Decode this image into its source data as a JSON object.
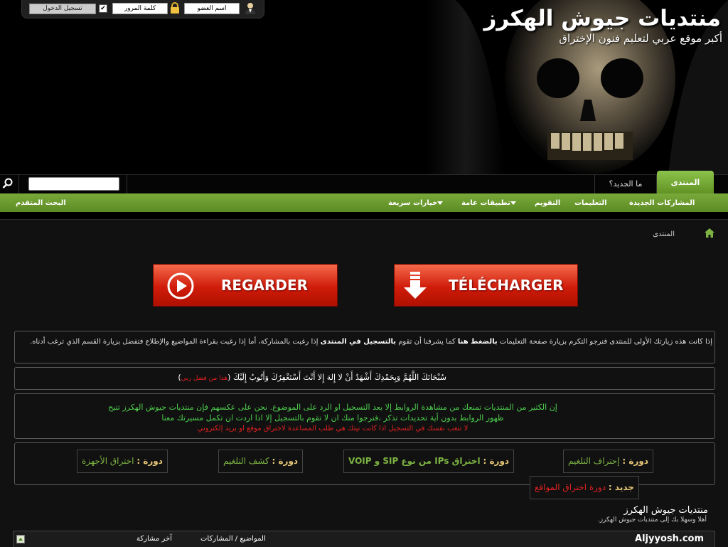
{
  "header": {
    "title": "منتديات جيوش الهكرز",
    "tagline": "أكبر موقع عربي لتعليم فنون الإختراق"
  },
  "login": {
    "username_placeholder": "اسم العضو",
    "password_placeholder": "كلمة المرور",
    "remember_checked": "✔",
    "login_button": "تسجيل الدخول"
  },
  "nav": {
    "forum_tab": "المنتدى",
    "whats_new_tab": "ما الجديد؟",
    "search_placeholder": ""
  },
  "subnav": {
    "items": [
      "المشاركات الجديدة",
      "التعليمات",
      "التقويم",
      "تطبيقات عامة",
      "خيارات سريعة"
    ],
    "advanced_search": "البحث المتقدم"
  },
  "breadcrumb": {
    "current": "المنتدى"
  },
  "buttons": {
    "watch": "REGARDER",
    "download": "TÉLÉCHARGER"
  },
  "welcome": {
    "part1": "إذا كانت هذه زيارتك الأولى للمنتدى فنرجو التكرم بزيارة صفحة التعليمات",
    "link1": "بالضغط هنا",
    "part2": "كما يشرفنا أن تقوم",
    "link2": "بالتسجيل في المنتدى",
    "part3": "إذا رغبت بالمشاركة، أما إذا رغبت بقراءة المواضيع والإطلاع فتفضل بزيارة القسم الذي ترغب أدناه."
  },
  "dhikr": {
    "text": "سُبْحَانَكَ اللَّهُمَّ وَبِحَمْدِكَ أَشْهَدُ أَنْ لا إِلهَ إِلا أَنْتَ أَسْتَغْفِرُكَ وَأَتُوبُ إِلَيْكَ (",
    "credit": "هذا من فضل ربي",
    "close": ")"
  },
  "notice": {
    "line1": "إن الكثير من المنتديات تمنعك من مشاهدة الروابط إلا بعد التسجيل او الرد على الموضوع. نحن على عكسهم فإن منتديات جيوش الهكرز تتيح",
    "line2": "ظهور الروابط بدون أية تحديدات تذكر ،فنرجوا منك ان لا تقوم بالتسجيل إلا اذا اردت ان تكمل مسيرتك معنا",
    "line3": "لا تتعب نفسك في التسجيل اذا كانت نيتك هي طلب المساعدة لاختراق موقع او بريد إلكتروني"
  },
  "courses": [
    {
      "prefix": "دورة :",
      "name": "إحتراف التلغيم"
    },
    {
      "prefix": "دورة :",
      "name": "اختراق IPs من نوع SIP و VOIP"
    },
    {
      "prefix": "دورة :",
      "name": "كشف التلغيم"
    },
    {
      "prefix": "دورة :",
      "name": "اختراق الأجهزة"
    }
  ],
  "new_course": {
    "prefix": "جديد :",
    "name": "دورة اختراق المواقع"
  },
  "forum_section": {
    "title": "منتديات جيوش الهكرز",
    "subtitle": "أهلا وسهلا بك إلى منتديات جيوش الهكرز."
  },
  "table_header": {
    "site": "Aljyyosh.com",
    "topics_posts": "المواضيع / المشاركات",
    "last_post": "آخر مشاركة"
  },
  "colors": {
    "nav_green": "#6a9b2e",
    "button_red": "#d01c0a",
    "notice_green": "#4dd04d",
    "notice_red": "#e02020"
  }
}
